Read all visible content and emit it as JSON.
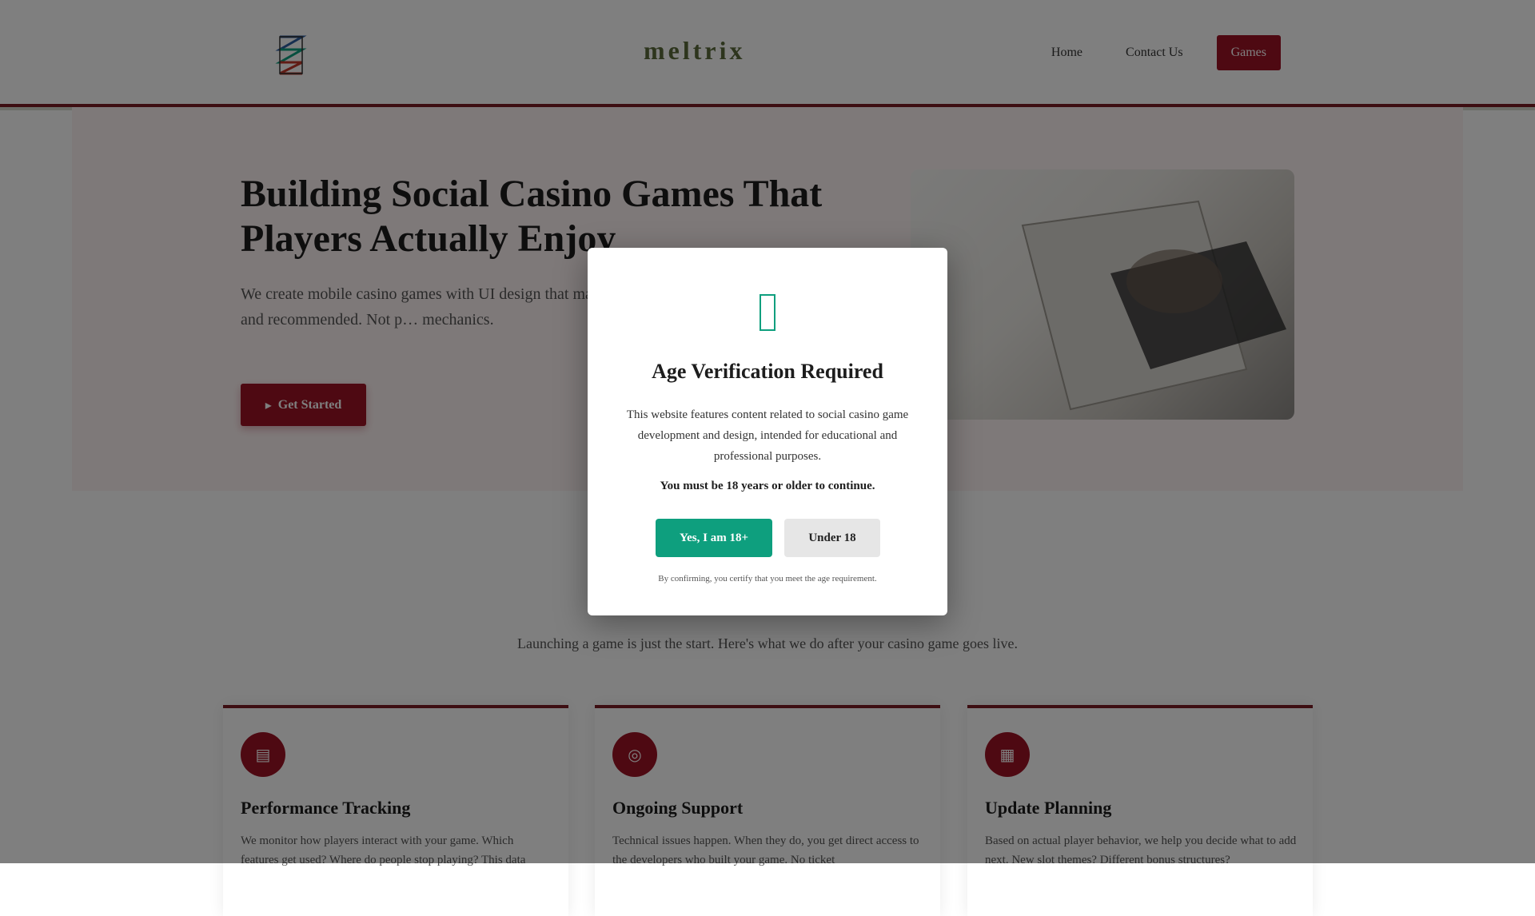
{
  "header": {
    "brand": "meltrix",
    "nav": {
      "home": "Home",
      "contact": "Contact Us",
      "games": "Games"
    }
  },
  "hero": {
    "title": "Building Social Casino Games That Players Actually Enjoy",
    "text": "We create mobile casino games with UI design that ma… that got downloaded, played, and recommended. Not p… mechanics.",
    "button_label": "Get Started"
  },
  "section": {
    "title": "W… …n",
    "subtitle": "Launching a game is just the start. Here's what we do after your casino game goes live."
  },
  "cards": [
    {
      "title": "Performance Tracking",
      "text": "We monitor how players interact with your game. Which features get used? Where do people stop playing? This data"
    },
    {
      "title": "Ongoing Support",
      "text": "Technical issues happen. When they do, you get direct access to the developers who built your game. No ticket"
    },
    {
      "title": "Update Planning",
      "text": "Based on actual player behavior, we help you decide what to add next. New slot themes? Different bonus structures?"
    }
  ],
  "modal": {
    "title": "Age Verification Required",
    "text": "This website features content related to social casino game development and design, intended for educational and professional purposes.",
    "warning": "You must be 18 years or older to continue.",
    "yes_label": "Yes, I am 18+",
    "no_label": "Under 18",
    "footer": "By confirming, you certify that you meet the age requirement."
  },
  "icons": {
    "modal": "warning-icon",
    "hero_button": "arrow-icon",
    "cards": [
      "chart-icon",
      "headset-icon",
      "calendar-icon"
    ]
  },
  "colors": {
    "primary": "#9c1224",
    "accent": "#0e9f7e",
    "brand": "#5a6b3a"
  }
}
